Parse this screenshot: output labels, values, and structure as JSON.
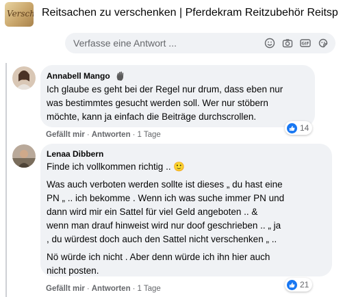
{
  "group": {
    "thumb_text": "Verschen",
    "title": "Reitsachen zu verschenken | Pferdekram Reitzubehör Reitsp"
  },
  "reply": {
    "placeholder": "Verfasse eine Antwort ...",
    "icons": [
      "smiley-icon",
      "camera-icon",
      "gif-icon",
      "sticker-icon"
    ]
  },
  "comments": [
    {
      "author": "Annabell Mango",
      "text": "Ich glaube es geht bei der Regel nur drum, dass eben nur\nwas bestimmtes gesucht werden soll. Wer nur stöbern\nmöchte, kann ja einfach die Beiträge durchscrollen.",
      "reaction_count": "14",
      "like": "Gefällt mir",
      "reply": "Antworten",
      "time": "1 Tage"
    },
    {
      "author": "Lenaa Dibbern",
      "text_1": "Finde ich vollkommen richtig .. 🙂",
      "text_2": "Was auch verboten werden sollte ist dieses „ du hast eine\nPN „ .. ich bekomme . Wenn ich was suche immer PN und\ndann wird mir ein Sattel für viel Geld angeboten .. &\nwenn man drauf hinweist wird nur doof geschrieben .. „ ja\n, du würdest doch auch den Sattel nicht verschenken „ ..",
      "text_3": "Nö würde ich nicht . Aber denn würde ich ihn hier auch\nnicht posten.",
      "reaction_count": "21",
      "like": "Gefällt mir",
      "reply": "Antworten",
      "time": "1 Tage"
    }
  ],
  "colors": {
    "bubble": "#f0f2f5",
    "like_blue": "#1877f2",
    "secondary_text": "#65676b"
  }
}
